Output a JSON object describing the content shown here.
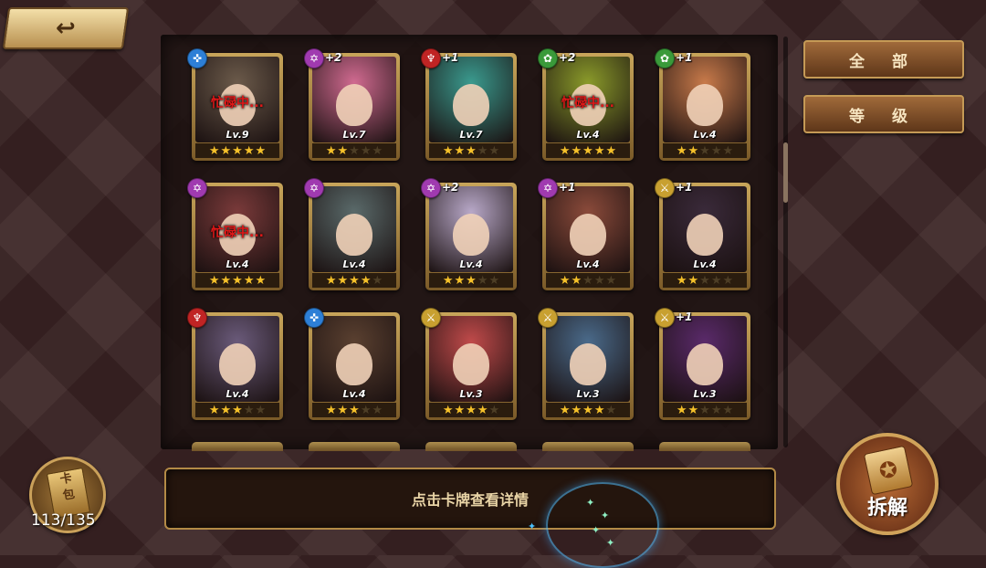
{
  "nav": {
    "back_icon": "↩"
  },
  "filters": {
    "all_label": "全 部",
    "level_label": "等 级"
  },
  "colors": {
    "shield": "#2d7fd6",
    "star_hex": "#a03ab0",
    "flame": "#c02424",
    "nature": "#3a9a3a",
    "sword": "#c8a030",
    "busy_text": "#e01818"
  },
  "cards": [
    {
      "element": "shield-icon",
      "glyph": "✜",
      "plus": "",
      "busy": "忙碌中...",
      "level": "Lv.9",
      "stars": 5,
      "art": "#6b5a4a"
    },
    {
      "element": "hexagram-icon",
      "glyph": "✡",
      "plus": "+2",
      "busy": "",
      "level": "Lv.7",
      "stars": 2,
      "art": "#d06a90"
    },
    {
      "element": "flame-icon",
      "glyph": "♆",
      "plus": "+1",
      "busy": "",
      "level": "Lv.7",
      "stars": 3,
      "art": "#3a9a8e"
    },
    {
      "element": "nature-icon",
      "glyph": "✿",
      "plus": "+2",
      "busy": "忙碌中...",
      "level": "Lv.4",
      "stars": 5,
      "art": "#8a9a2a"
    },
    {
      "element": "nature-icon",
      "glyph": "✿",
      "plus": "+1",
      "busy": "",
      "level": "Lv.4",
      "stars": 2,
      "art": "#c87a4a"
    },
    {
      "element": "hexagram-icon",
      "glyph": "✡",
      "plus": "",
      "busy": "忙碌中...",
      "level": "Lv.4",
      "stars": 5,
      "art": "#7a3a3a"
    },
    {
      "element": "hexagram-icon",
      "glyph": "✡",
      "plus": "",
      "busy": "",
      "level": "Lv.4",
      "stars": 4,
      "art": "#5a6a6a"
    },
    {
      "element": "hexagram-icon",
      "glyph": "✡",
      "plus": "+2",
      "busy": "",
      "level": "Lv.4",
      "stars": 3,
      "art": "#b8a8c8"
    },
    {
      "element": "hexagram-icon",
      "glyph": "✡",
      "plus": "+1",
      "busy": "",
      "level": "Lv.4",
      "stars": 2,
      "art": "#8a4a3a"
    },
    {
      "element": "sword-icon",
      "glyph": "⚔",
      "plus": "+1",
      "busy": "",
      "level": "Lv.4",
      "stars": 2,
      "art": "#3a2a3a"
    },
    {
      "element": "flame-icon",
      "glyph": "♆",
      "plus": "",
      "busy": "",
      "level": "Lv.4",
      "stars": 3,
      "art": "#6a5a7a"
    },
    {
      "element": "shield-icon",
      "glyph": "✜",
      "plus": "",
      "busy": "",
      "level": "Lv.4",
      "stars": 3,
      "art": "#5a4030"
    },
    {
      "element": "sword-icon",
      "glyph": "⚔",
      "plus": "",
      "busy": "",
      "level": "Lv.3",
      "stars": 4,
      "art": "#c04a4a"
    },
    {
      "element": "sword-icon",
      "glyph": "⚔",
      "plus": "",
      "busy": "",
      "level": "Lv.3",
      "stars": 4,
      "art": "#4a6a8a"
    },
    {
      "element": "sword-icon",
      "glyph": "⚔",
      "plus": "+1",
      "busy": "",
      "level": "Lv.3",
      "stars": 2,
      "art": "#5a2a6a"
    }
  ],
  "footer": {
    "pack_label": "卡\n包",
    "card_count": "113/135",
    "hint_text": "点击卡牌查看详情",
    "dismantle_label": "拆解"
  }
}
